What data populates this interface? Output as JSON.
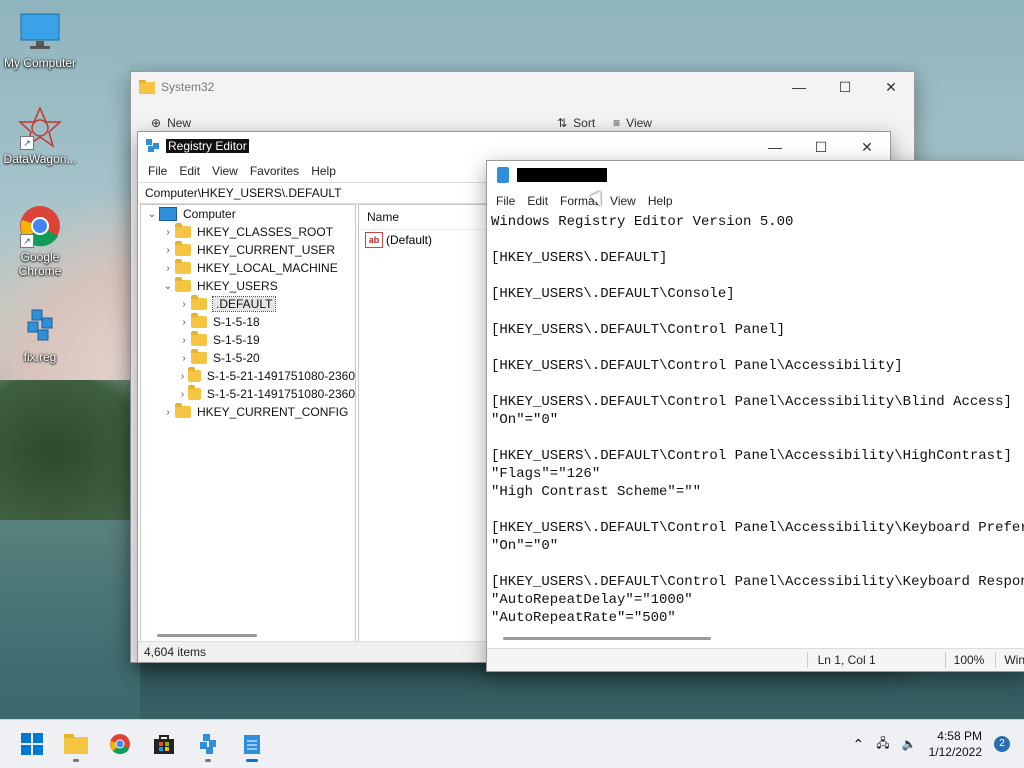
{
  "desktop": {
    "icons": [
      {
        "label": "My Computer"
      },
      {
        "label": "DataWagon..."
      },
      {
        "label": "Google Chrome"
      },
      {
        "label": "fix.reg"
      }
    ]
  },
  "explorer": {
    "title": "System32",
    "commands": [
      "New",
      "Sort",
      "View"
    ]
  },
  "regedit": {
    "title": "Registry Editor",
    "menu": [
      "File",
      "Edit",
      "View",
      "Favorites",
      "Help"
    ],
    "address": "Computer\\HKEY_USERS\\.DEFAULT",
    "tree": {
      "root": "Computer",
      "items": [
        {
          "label": "HKEY_CLASSES_ROOT"
        },
        {
          "label": "HKEY_CURRENT_USER"
        },
        {
          "label": "HKEY_LOCAL_MACHINE"
        },
        {
          "label": "HKEY_USERS"
        },
        {
          "label": ".DEFAULT"
        },
        {
          "label": "S-1-5-18"
        },
        {
          "label": "S-1-5-19"
        },
        {
          "label": "S-1-5-20"
        },
        {
          "label": "S-1-5-21-1491751080-2360"
        },
        {
          "label": "S-1-5-21-1491751080-2360"
        },
        {
          "label": "HKEY_CURRENT_CONFIG"
        }
      ]
    },
    "columns": {
      "name": "Name"
    },
    "values": [
      {
        "icon": "ab",
        "name": "(Default)"
      }
    ],
    "status": "4,604 items"
  },
  "notepad": {
    "menu": [
      "File",
      "Edit",
      "Format",
      "View",
      "Help"
    ],
    "lines": [
      "Windows Registry Editor Version 5.00",
      "",
      "[HKEY_USERS\\.DEFAULT]",
      "",
      "[HKEY_USERS\\.DEFAULT\\Console]",
      "",
      "[HKEY_USERS\\.DEFAULT\\Control Panel]",
      "",
      "[HKEY_USERS\\.DEFAULT\\Control Panel\\Accessibility]",
      "",
      "[HKEY_USERS\\.DEFAULT\\Control Panel\\Accessibility\\Blind Access]",
      "\"On\"=\"0\"",
      "",
      "[HKEY_USERS\\.DEFAULT\\Control Panel\\Accessibility\\HighContrast]",
      "\"Flags\"=\"126\"",
      "\"High Contrast Scheme\"=\"\"",
      "",
      "[HKEY_USERS\\.DEFAULT\\Control Panel\\Accessibility\\Keyboard Preferenc",
      "\"On\"=\"0\"",
      "",
      "[HKEY_USERS\\.DEFAULT\\Control Panel\\Accessibility\\Keyboard Response]",
      "\"AutoRepeatDelay\"=\"1000\"",
      "\"AutoRepeatRate\"=\"500\""
    ],
    "status": {
      "position": "Ln 1, Col 1",
      "zoom": "100%",
      "eol": "Win"
    }
  },
  "taskbar": {
    "time": "4:58 PM",
    "date": "1/12/2022",
    "notifications": "2"
  }
}
